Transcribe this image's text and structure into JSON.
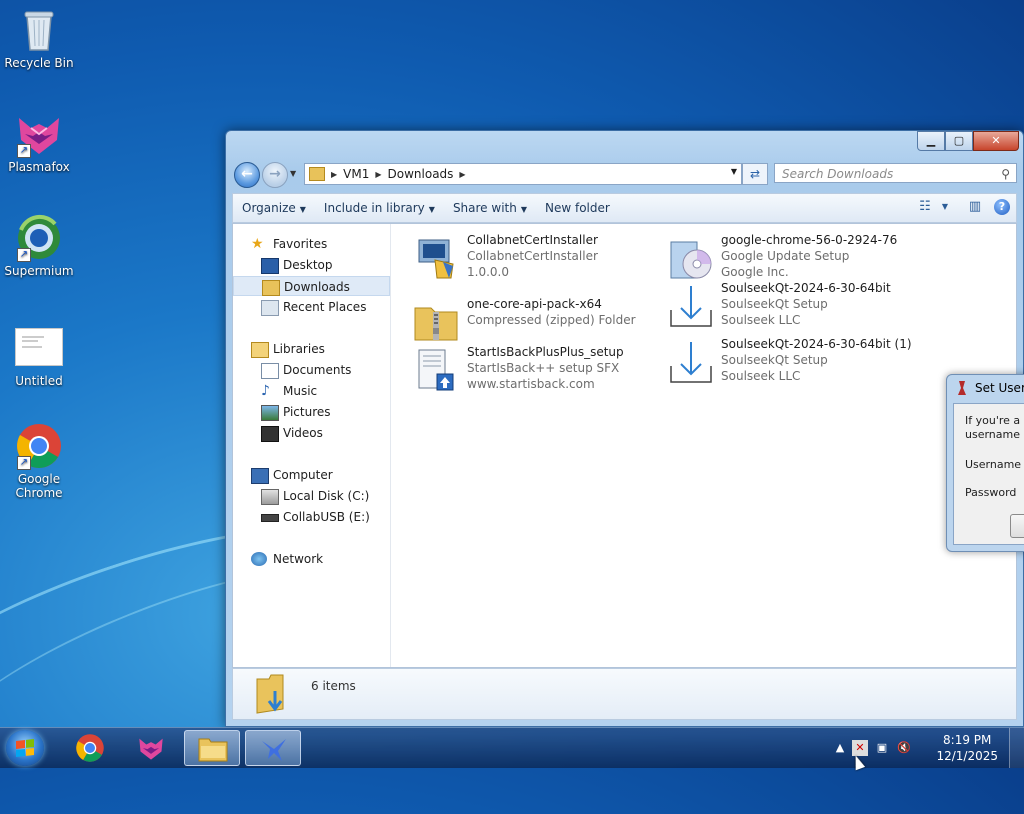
{
  "desktop": {
    "icons": [
      {
        "label": "Recycle Bin",
        "icon": "recycle-bin-icon"
      },
      {
        "label": "Plasmafox",
        "icon": "plasmafox-icon"
      },
      {
        "label": "Supermium",
        "icon": "supermium-icon"
      },
      {
        "label": "Untitled",
        "icon": "document-icon"
      },
      {
        "label": "Google Chrome",
        "icon": "chrome-icon"
      }
    ]
  },
  "explorer": {
    "address": {
      "segments": [
        "VM1",
        "Downloads"
      ]
    },
    "search_placeholder": "Search Downloads",
    "toolbar": {
      "organize": "Organize",
      "include_in_library": "Include in library",
      "share_with": "Share with",
      "new_folder": "New folder"
    },
    "nav": {
      "favorites": "Favorites",
      "desktop": "Desktop",
      "downloads": "Downloads",
      "recent_places": "Recent Places",
      "libraries": "Libraries",
      "documents": "Documents",
      "music": "Music",
      "pictures": "Pictures",
      "videos": "Videos",
      "computer": "Computer",
      "local_disk": "Local Disk (C:)",
      "collabusb": "CollabUSB (E:)",
      "network": "Network"
    },
    "files": [
      {
        "name": "CollabnetCertInstaller",
        "line2": "CollabnetCertInstaller",
        "line3": "1.0.0.0"
      },
      {
        "name": "google-chrome-56-0-2924-76",
        "line2": "Google Update Setup",
        "line3": "Google Inc."
      },
      {
        "name": "one-core-api-pack-x64",
        "line2": "Compressed (zipped) Folder",
        "line3": ""
      },
      {
        "name": "SoulseekQt-2024-6-30-64bit",
        "line2": "SoulseekQt Setup",
        "line3": "Soulseek LLC"
      },
      {
        "name": "StartIsBackPlusPlus_setup",
        "line2": "StartIsBack++ setup SFX",
        "line3": "www.startisback.com"
      },
      {
        "name": "SoulseekQt-2024-6-30-64bit (1)",
        "line2": "SoulseekQt Setup",
        "line3": "Soulseek LLC"
      }
    ],
    "item_count": "6 items"
  },
  "dialog": {
    "title": "Set Usern",
    "message_line1": "If you're a n",
    "message_line2": "username an",
    "username_label": "Username",
    "password_label": "Password"
  },
  "taskbar": {
    "time": "8:19 PM",
    "date": "12/1/2025"
  },
  "colors": {
    "desktop_bg": "#1b78c8",
    "selection": "#dfeaf7",
    "taskbar": "#1a3f77"
  }
}
